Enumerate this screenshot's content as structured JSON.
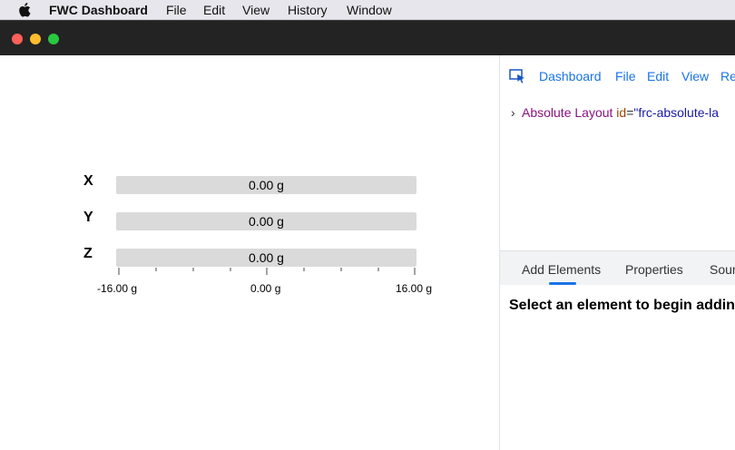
{
  "menubar": {
    "app_name": "FWC Dashboard",
    "items": [
      "File",
      "Edit",
      "View",
      "History",
      "Window"
    ]
  },
  "accelerometer": {
    "axes": [
      {
        "label": "X",
        "value": "0.00 g"
      },
      {
        "label": "Y",
        "value": "0.00 g"
      },
      {
        "label": "Z",
        "value": "0.00 g"
      }
    ],
    "scale_labels": [
      "-16.00 g",
      "0.00 g",
      "16.00 g"
    ],
    "min": -16,
    "max": 16
  },
  "panel": {
    "toolbar_items": [
      "Dashboard",
      "File",
      "Edit",
      "View",
      "Re"
    ],
    "tree": {
      "tag": "Absolute Layout",
      "attr_name": "id",
      "attr_value": "\"frc-absolute-la"
    },
    "tabs": [
      "Add Elements",
      "Properties",
      "Sour"
    ],
    "active_tab": "Add Elements",
    "hint": "Select an element to begin addin"
  },
  "colors": {
    "accent": "#1a73e8",
    "bar_fill": "#dadada",
    "titlebar": "#232323"
  }
}
